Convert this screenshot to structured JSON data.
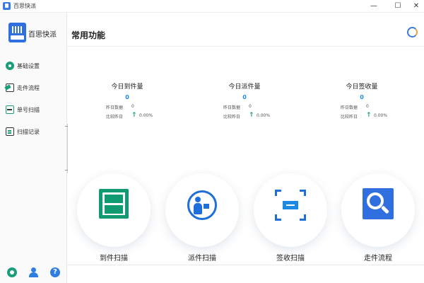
{
  "window": {
    "title": "百思快派",
    "minimize": "—",
    "maximize": "☐",
    "close": "✕"
  },
  "sidebar": {
    "logo_text": "百思快派",
    "items": [
      {
        "label": "基础设置",
        "icon": "gear-icon"
      },
      {
        "label": "走件流程",
        "icon": "flow-icon"
      },
      {
        "label": "单号扫描",
        "icon": "scan-icon"
      },
      {
        "label": "扫描记录",
        "icon": "record-icon"
      }
    ],
    "footer": {
      "settings_icon": "gear-icon",
      "user_icon": "user-icon",
      "help_label": "?"
    }
  },
  "header": {
    "title": "常用功能",
    "refresh_icon": "refresh-icon"
  },
  "stats": [
    {
      "title": "今日到件量",
      "value": "0",
      "yesterday_label": "昨日数据",
      "yesterday_value": "0",
      "compare_label": "比较昨日",
      "compare_arrow": "↑",
      "compare_value": "0.00%"
    },
    {
      "title": "今日派件量",
      "value": "0",
      "yesterday_label": "昨日数据",
      "yesterday_value": "0",
      "compare_label": "比较昨日",
      "compare_arrow": "↑",
      "compare_value": "0.00%"
    },
    {
      "title": "今日签收量",
      "value": "0",
      "yesterday_label": "昨日数据",
      "yesterday_value": "0",
      "compare_label": "比较昨日",
      "compare_arrow": "↑",
      "compare_value": "0.00%"
    }
  ],
  "functions": [
    {
      "label": "到件扫描",
      "icon": "arrival-scan-icon"
    },
    {
      "label": "派件扫描",
      "icon": "dispatch-scan-icon"
    },
    {
      "label": "签收扫描",
      "icon": "sign-scan-icon"
    },
    {
      "label": "走件流程",
      "icon": "flow-search-icon"
    }
  ],
  "colors": {
    "accent_green": "#0f9a72",
    "accent_blue": "#1e6fd9",
    "value_blue": "#1e88e5"
  }
}
